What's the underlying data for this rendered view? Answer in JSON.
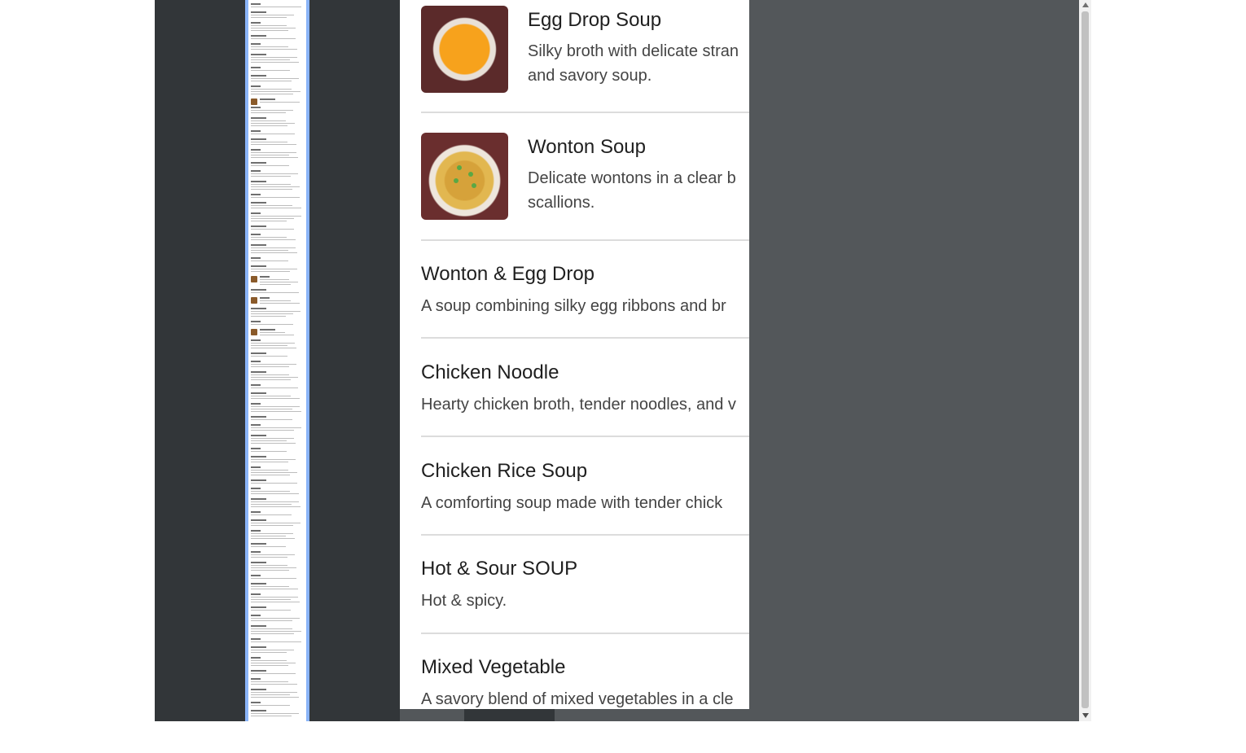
{
  "menu": {
    "items": [
      {
        "name": "Egg Drop Soup",
        "desc_lines": [
          "Silky broth with delicate stran",
          "and savory soup."
        ],
        "image": "egg-drop-soup-photo"
      },
      {
        "name": "Wonton Soup",
        "desc_lines": [
          "Delicate wontons in a clear b",
          "scallions."
        ],
        "image": "wonton-soup-photo"
      },
      {
        "name": "Wonton & Egg Drop",
        "desc_lines": [
          "A soup combining silky egg ribbons and br"
        ]
      },
      {
        "name": "Chicken Noodle",
        "desc_lines": [
          "Hearty chicken broth, tender noodles, and v"
        ]
      },
      {
        "name": "Chicken Rice Soup",
        "desc_lines": [
          "A comforting soup made with tender chick"
        ]
      },
      {
        "name": "Hot & Sour SOUP",
        "desc_lines": [
          "Hot & spicy."
        ]
      },
      {
        "name": "Mixed Vegetable",
        "desc_lines": [
          "A savory blend of mixed vegetables in a cle"
        ]
      }
    ]
  },
  "colors": {
    "viewer_bg": "#53575a",
    "sidebar_bg": "#323639",
    "thumbnail_highlight": "#8ab4f8"
  }
}
